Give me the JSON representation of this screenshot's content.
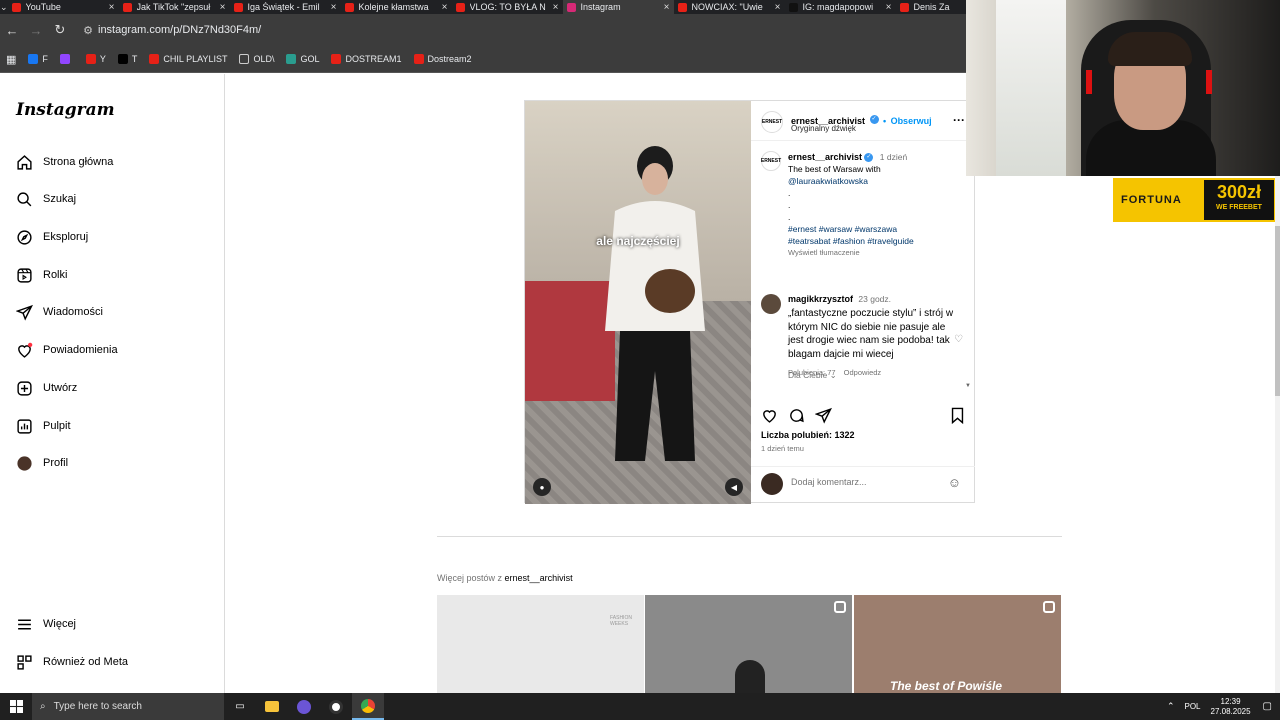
{
  "browser": {
    "tabs": [
      {
        "label": "YouTube",
        "icon_color": "#e62117",
        "active": false
      },
      {
        "label": "Jak TikTok \"zepsuł",
        "icon_color": "#e62117",
        "active": false
      },
      {
        "label": "Iga Świątek - Emil",
        "icon_color": "#e62117",
        "active": false
      },
      {
        "label": "Kolejne kłamstwa",
        "icon_color": "#e62117",
        "active": false
      },
      {
        "label": "VLOG: TO BYŁA N",
        "icon_color": "#e62117",
        "active": false
      },
      {
        "label": "Instagram",
        "icon_color": "#d62976",
        "active": true
      },
      {
        "label": "NOWCIAX: \"Uwie",
        "icon_color": "#e62117",
        "active": false
      },
      {
        "label": "IG: magdapopowi",
        "icon_color": "#111111",
        "active": false
      },
      {
        "label": "Denis Za",
        "icon_color": "#e62117",
        "active": false
      }
    ],
    "url": "instagram.com/p/DNz7Nd30F4m/",
    "bookmarks": [
      {
        "label": "F",
        "icon": "facebook-icon"
      },
      {
        "label": "",
        "icon": "twitch-icon"
      },
      {
        "label": "Y",
        "icon": "youtube-icon"
      },
      {
        "label": "T",
        "icon": "x-icon"
      },
      {
        "label": "CHIL PLAYLIST",
        "icon": "youtube-icon"
      },
      {
        "label": "OLD\\",
        "icon": "folder-icon"
      },
      {
        "label": "GOL",
        "icon": "gol-icon"
      },
      {
        "label": "DOSTREAM1",
        "icon": "youtube-icon"
      },
      {
        "label": "Dostream2",
        "icon": "youtube-icon"
      }
    ]
  },
  "sidebar": {
    "logo": "Instagram",
    "items": [
      {
        "label": "Strona główna",
        "icon": "home-icon"
      },
      {
        "label": "Szukaj",
        "icon": "search-icon"
      },
      {
        "label": "Eksploruj",
        "icon": "compass-icon"
      },
      {
        "label": "Rolki",
        "icon": "reels-icon"
      },
      {
        "label": "Wiadomości",
        "icon": "send-icon"
      },
      {
        "label": "Powiadomienia",
        "icon": "heart-icon"
      },
      {
        "label": "Utwórz",
        "icon": "plus-icon"
      },
      {
        "label": "Pulpit",
        "icon": "dashboard-icon"
      },
      {
        "label": "Profil",
        "icon": "avatar-icon"
      }
    ],
    "bottom": [
      {
        "label": "Więcej",
        "icon": "menu-icon"
      },
      {
        "label": "Również od Meta",
        "icon": "meta-icon"
      }
    ]
  },
  "post": {
    "video_caption": "ale najczęściej",
    "username": "ernest__archivist",
    "follow": "Obserwuj",
    "audio": "Oryginalny dźwięk",
    "avatar_text": "ERNEST",
    "caption": {
      "time": "1 dzień",
      "line1": "The best of Warsaw with",
      "mention": "@lauraakwiatkowska",
      "dots": ".",
      "hashtags1": "#ernest #warsaw #warszawa",
      "hashtags2": "#teatrsabat #fashion  #travelguide",
      "translate": "Wyświetl tłumaczenie"
    },
    "sort": "Dla Ciebie",
    "comment": {
      "user": "magikkrzysztof",
      "time": "23 godz.",
      "text": "„fantastyczne poczucie stylu” i strój w którym NIC do siebie nie pasuje ale jest drogie wiec nam sie podoba! tak blagam dajcie mi wiecej",
      "likes": "Polubienia: 77",
      "reply": "Odpowiedz"
    },
    "likes": "Liczba polubień: 1322",
    "posted": "1 dzień temu",
    "add_comment_placeholder": "Dodaj komentarz..."
  },
  "more_posts": {
    "prefix": "Więcej postów z",
    "user": "ernest__archivist",
    "thumbs": [
      {
        "bg": "#e9e9e9",
        "label": "FASHION WEEKS"
      },
      {
        "bg": "#8a8a8a",
        "label": ""
      },
      {
        "bg": "#9c7e6e",
        "label": "The best of Powiśle"
      }
    ]
  },
  "overlay": {
    "brand": "FORTUNA",
    "amount": "300zł",
    "tag": "WE FREEBET"
  },
  "taskbar": {
    "search": "Type here to search",
    "lang": "POL",
    "time": "12:39",
    "date": "27.08.2025"
  }
}
